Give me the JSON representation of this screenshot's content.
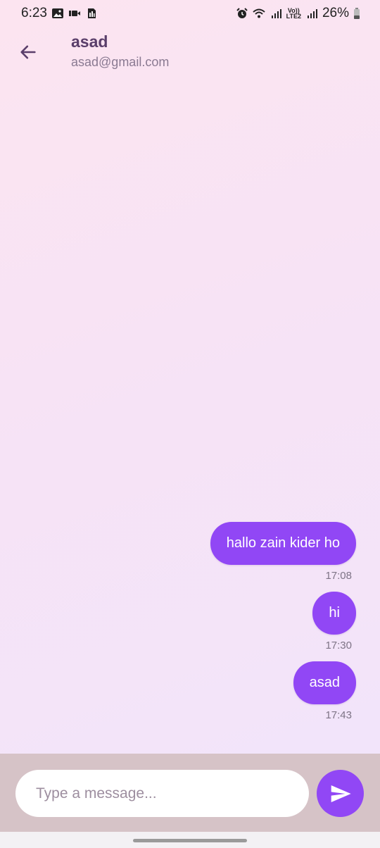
{
  "status_bar": {
    "time": "6:23",
    "battery": "26%",
    "volte_top": "Vo))",
    "volte_bottom": "LTE2",
    "icons": [
      "gallery-icon",
      "video-icon",
      "sim-icon",
      "alarm-icon",
      "wifi-icon",
      "signal-icon",
      "signal-icon",
      "battery-icon"
    ]
  },
  "header": {
    "name": "asad",
    "email": "asad@gmail.com",
    "back_icon": "arrow-left-icon"
  },
  "messages": [
    {
      "text": "hallo zain kider ho",
      "time": "17:08",
      "sent": true
    },
    {
      "text": "hi",
      "time": "17:30",
      "sent": true
    },
    {
      "text": "asad",
      "time": "17:43",
      "sent": true
    }
  ],
  "composer": {
    "placeholder": "Type a message...",
    "value": "",
    "send_icon": "send-icon"
  },
  "colors": {
    "accent": "#9147f5",
    "composer_bg": "#d6c3c7",
    "name_text": "#5a3e6a"
  }
}
